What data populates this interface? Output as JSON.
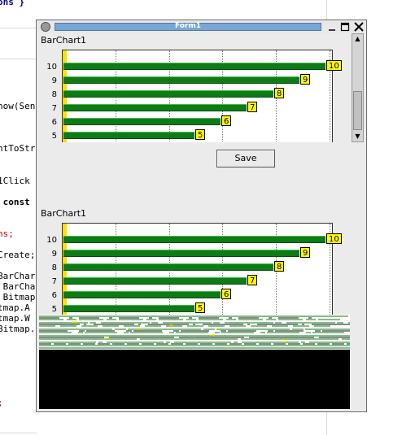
{
  "background_code": {
    "lines": [
      "ons }",
      "how(Sen",
      "ntToStr",
      "1Click",
      " const",
      "ns;",
      "Create;",
      "BarChar",
      " BarCha",
      " Bitmap",
      "tmap.A",
      "tmap.W",
      "Bitmap.",
      ";"
    ]
  },
  "window": {
    "title": "Form1",
    "icons": [
      "app-icon",
      "minimize-icon",
      "maximize-icon",
      "close-icon"
    ]
  },
  "charts": [
    {
      "name": "BarChart1",
      "y_labels": [
        "10",
        "9",
        "8",
        "7",
        "6",
        "5"
      ],
      "value_labels": [
        "10",
        "9",
        "8",
        "7",
        "6",
        "5"
      ],
      "values": [
        10,
        9,
        8,
        7,
        6,
        5
      ],
      "max": 10
    },
    {
      "name": "BarChart1",
      "y_labels": [
        "10",
        "9",
        "8",
        "7",
        "6",
        "5"
      ],
      "value_labels": [
        "10",
        "9",
        "8",
        "7",
        "6",
        "5"
      ],
      "values": [
        10,
        9,
        8,
        7,
        6,
        5
      ],
      "max": 10
    }
  ],
  "save_button": "Save",
  "colors": {
    "bar": "#0f7b17",
    "value_label": "#fff800",
    "title_bar": "#7aa6d6",
    "lower_area": "#000000"
  }
}
